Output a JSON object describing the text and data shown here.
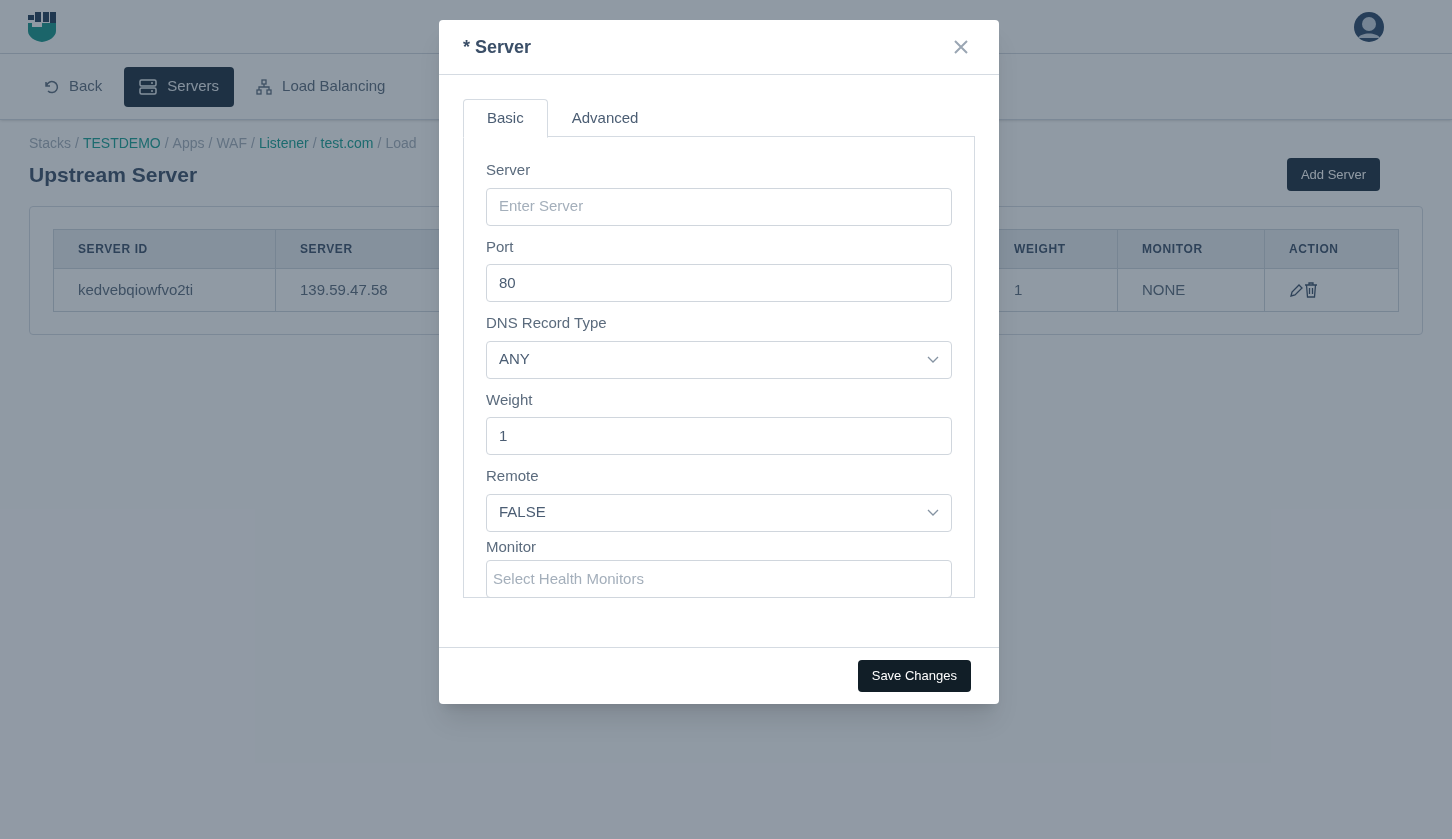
{
  "header": {
    "nav": [
      {
        "label": "Back",
        "selected": false
      },
      {
        "label": "Servers",
        "selected": true
      },
      {
        "label": "Load Balancing",
        "selected": false
      }
    ]
  },
  "breadcrumb": [
    {
      "label": "Stacks",
      "link": false
    },
    {
      "separator": "/",
      "label": "TESTDEMO",
      "link": true
    },
    {
      "separator": "/",
      "label": "Apps",
      "link": false
    },
    {
      "separator": "/",
      "label": "WAF",
      "link": false
    },
    {
      "separator": "/",
      "label": "Listener",
      "link": true
    },
    {
      "separator": "/",
      "label": "test.com",
      "link": true
    },
    {
      "separator": "/",
      "label": "Load",
      "link": false
    }
  ],
  "page_title": "Upstream Server",
  "add_button": "Add Server",
  "table": {
    "columns": [
      "SERVER ID",
      "SERVER",
      "WEIGHT",
      "MONITOR",
      "ACTION"
    ],
    "rows": [
      {
        "cells": [
          "kedvebqiowfvo2ti",
          "139.59.47.58",
          "1",
          "NONE"
        ]
      }
    ]
  },
  "modal": {
    "title": "* Server",
    "tabs": [
      {
        "label": "Basic",
        "selected": true
      },
      {
        "label": "Advanced",
        "selected": false
      }
    ],
    "fields": [
      {
        "label": "Server",
        "kind": "input",
        "placeholder": "Enter Server"
      },
      {
        "label": "Port",
        "kind": "input",
        "value": "80"
      },
      {
        "label": "DNS Record Type",
        "kind": "select",
        "value": "ANY"
      },
      {
        "label": "Weight",
        "kind": "input",
        "value": "1"
      },
      {
        "label": "Remote",
        "kind": "select",
        "value": "FALSE"
      },
      {
        "label": "Monitor",
        "kind": "multiselect",
        "placeholder": "Select Health Monitors"
      }
    ],
    "save_button": "Save Changes"
  }
}
